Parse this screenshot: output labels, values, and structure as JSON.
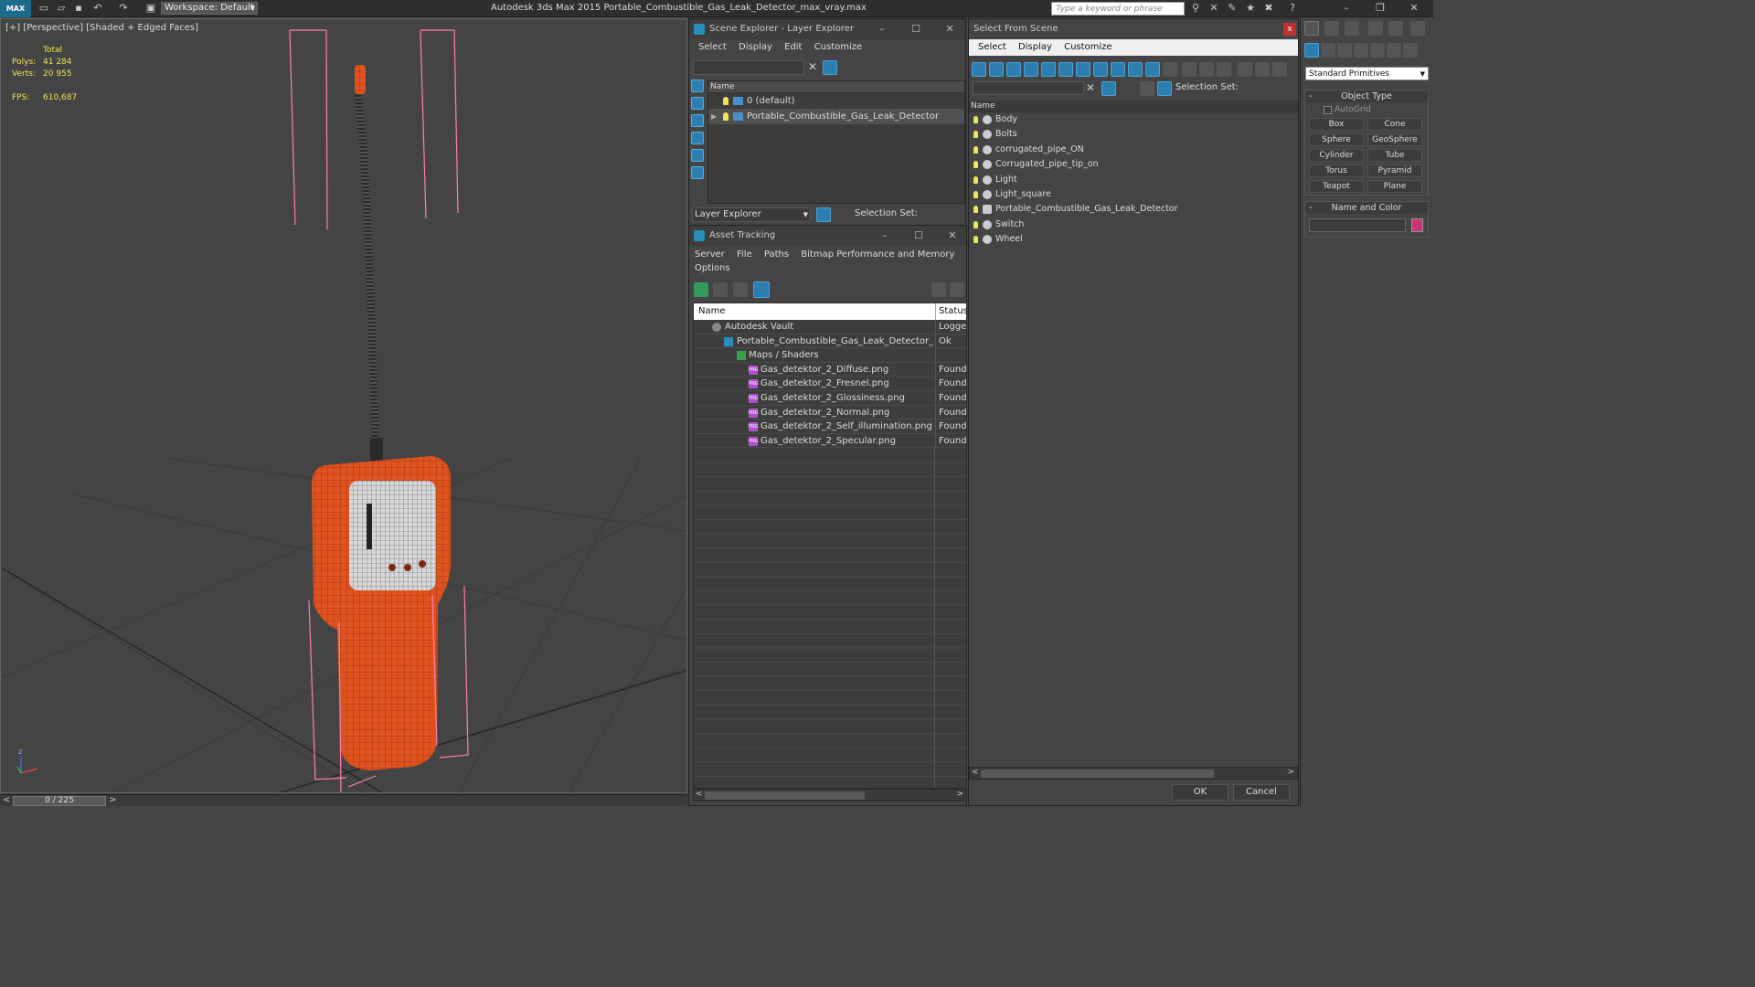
{
  "app": {
    "title": "Autodesk 3ds Max  2015     Portable_Combustible_Gas_Leak_Detector_max_vray.max",
    "logo": "MAX",
    "workspace": "Workspace: Default",
    "search_placeholder": "Type a keyword or phrase"
  },
  "viewport": {
    "label": "[+] [Perspective] [Shaded + Edged Faces]",
    "stats": {
      "total_label": "Total",
      "polys_label": "Polys:",
      "polys": "41 284",
      "verts_label": "Verts:",
      "verts": "20 955",
      "fps_label": "FPS:",
      "fps": "610,687"
    },
    "axis_z": "z",
    "timeline": "0 / 225"
  },
  "scene_explorer": {
    "title": "Scene Explorer - Layer Explorer",
    "menu": [
      "Select",
      "Display",
      "Edit",
      "Customize"
    ],
    "column": "Name",
    "rows": [
      "0 (default)",
      "Portable_Combustible_Gas_Leak_Detector"
    ],
    "bottom_dropdown": "Layer Explorer",
    "selection_set": "Selection Set:"
  },
  "asset_tracking": {
    "title": "Asset Tracking",
    "menu1": [
      "Server",
      "File",
      "Paths",
      "Bitmap Performance and Memory"
    ],
    "menu2": [
      "Options"
    ],
    "columns": [
      "Name",
      "Status"
    ],
    "rows": [
      {
        "name": "Autodesk Vault",
        "status": "Loggec"
      },
      {
        "name": "Portable_Combustible_Gas_Leak_Detector_max_...",
        "status": "Ok"
      },
      {
        "name": "Maps / Shaders",
        "status": ""
      },
      {
        "name": "Gas_detektor_2_Diffuse.png",
        "status": "Found"
      },
      {
        "name": "Gas_detektor_2_Fresnel.png",
        "status": "Found"
      },
      {
        "name": "Gas_detektor_2_Glossiness.png",
        "status": "Found"
      },
      {
        "name": "Gas_detektor_2_Normal.png",
        "status": "Found"
      },
      {
        "name": "Gas_detektor_2_Self_illumination.png",
        "status": "Found"
      },
      {
        "name": "Gas_detektor_2_Specular.png",
        "status": "Found"
      }
    ]
  },
  "select_from_scene": {
    "title": "Select From Scene",
    "close": "x",
    "menu": [
      "Select",
      "Display",
      "Customize"
    ],
    "selection_set": "Selection Set:",
    "column": "Name",
    "objects": [
      "Body",
      "Bolts",
      "corrugated_pipe_ON",
      "Corrugated_pipe_tip_on",
      "Light",
      "Light_square",
      "Portable_Combustible_Gas_Leak_Detector",
      "Switch",
      "Wheel"
    ],
    "ok": "OK",
    "cancel": "Cancel"
  },
  "command_panel": {
    "dropdown": "Standard Primitives",
    "object_type_title": "Object Type",
    "autogrid": "AutoGrid",
    "buttons": [
      "Box",
      "Cone",
      "Sphere",
      "GeoSphere",
      "Cylinder",
      "Tube",
      "Torus",
      "Pyramid",
      "Teapot",
      "Plane"
    ],
    "name_color_title": "Name and Color",
    "swatch_color": "#cc3377"
  },
  "colors": {
    "detector_orange": "#e0531f",
    "bbox_pink": "#ff7fb0",
    "stats_yellow": "#f2e35a"
  }
}
